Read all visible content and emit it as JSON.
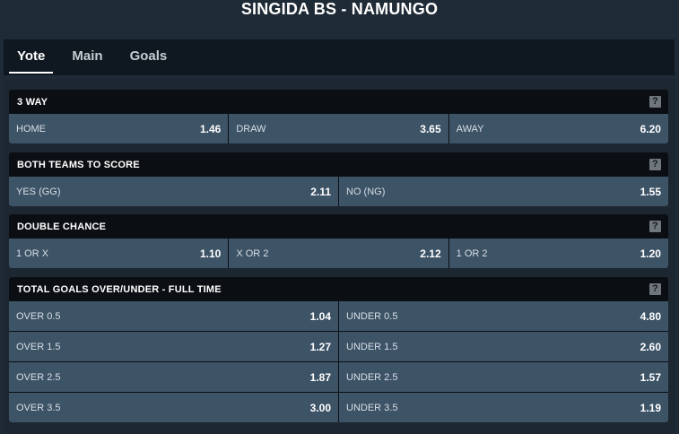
{
  "match_title": "SINGIDA BS - NAMUNGO",
  "tabs": [
    {
      "label": "Yote"
    },
    {
      "label": "Main"
    },
    {
      "label": "Goals"
    }
  ],
  "help_glyph": "?",
  "markets": [
    {
      "title": "3 WAY",
      "rows": [
        [
          {
            "label": "HOME",
            "odd": "1.46"
          },
          {
            "label": "DRAW",
            "odd": "3.65"
          },
          {
            "label": "AWAY",
            "odd": "6.20"
          }
        ]
      ]
    },
    {
      "title": "BOTH TEAMS TO SCORE",
      "rows": [
        [
          {
            "label": "YES (GG)",
            "odd": "2.11"
          },
          {
            "label": "NO (NG)",
            "odd": "1.55"
          }
        ]
      ]
    },
    {
      "title": "DOUBLE CHANCE",
      "rows": [
        [
          {
            "label": "1 OR X",
            "odd": "1.10"
          },
          {
            "label": "X OR 2",
            "odd": "2.12"
          },
          {
            "label": "1 OR 2",
            "odd": "1.20"
          }
        ]
      ]
    },
    {
      "title": "TOTAL GOALS OVER/UNDER - FULL TIME",
      "rows": [
        [
          {
            "label": "OVER 0.5",
            "odd": "1.04"
          },
          {
            "label": "UNDER 0.5",
            "odd": "4.80"
          }
        ],
        [
          {
            "label": "OVER 1.5",
            "odd": "1.27"
          },
          {
            "label": "UNDER 1.5",
            "odd": "2.60"
          }
        ],
        [
          {
            "label": "OVER 2.5",
            "odd": "1.87"
          },
          {
            "label": "UNDER 2.5",
            "odd": "1.57"
          }
        ],
        [
          {
            "label": "OVER 3.5",
            "odd": "3.00"
          },
          {
            "label": "UNDER 3.5",
            "odd": "1.19"
          }
        ]
      ]
    }
  ]
}
